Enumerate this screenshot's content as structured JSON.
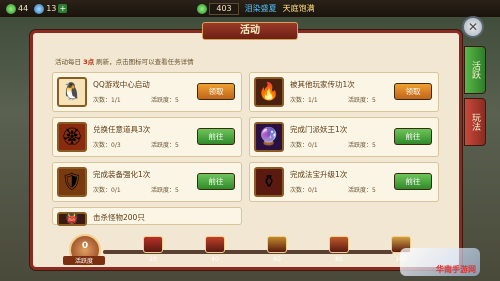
{
  "top_bar": {
    "level": "44",
    "stamina": "13",
    "gold": "403",
    "status1": "泪染盛夏",
    "status2": "天庭饱满"
  },
  "window": {
    "title": "活动",
    "close_icon": "close-icon"
  },
  "side_tabs": [
    {
      "label": "活跃"
    },
    {
      "label": "玩法"
    }
  ],
  "tip": {
    "prefix": "活动每日 ",
    "highlight": "3点",
    "suffix": " 刷新，点击图标可以查看任务详情"
  },
  "tasks": [
    {
      "name": "QQ游戏中心启动",
      "count": "次数：1/1",
      "active": "活跃度：5",
      "button": "领取",
      "type": "claim",
      "icon": "penguin-icon",
      "glyph": "🐧",
      "iconbg": "#f7e3b8"
    },
    {
      "name": "被其他玩家传功1次",
      "count": "次数：1/1",
      "active": "活跃度：5",
      "button": "领取",
      "type": "claim",
      "icon": "mage-silhouette-icon",
      "glyph": "🔥",
      "iconbg": "#4a2010"
    },
    {
      "name": "兑换任意道具3次",
      "count": "次数：0/3",
      "active": "活跃度：5",
      "button": "前往",
      "type": "go",
      "icon": "medallion-icon",
      "glyph": "🏵",
      "iconbg": "#8a2b10"
    },
    {
      "name": "完成门派妖王1次",
      "count": "次数：0/1",
      "active": "活跃度：5",
      "button": "前往",
      "type": "go",
      "icon": "purple-orb-icon",
      "glyph": "🔮",
      "iconbg": "#2a1040"
    },
    {
      "name": "完成装备强化1次",
      "count": "次数：0/1",
      "active": "活跃度：5",
      "button": "前往",
      "type": "go",
      "icon": "armor-icon",
      "glyph": "🛡",
      "iconbg": "#7a3a10"
    },
    {
      "name": "完成法宝升级1次",
      "count": "次数：0/1",
      "active": "活跃度：5",
      "button": "前往",
      "type": "go",
      "icon": "treasure-icon",
      "glyph": "⚱",
      "iconbg": "#5a1a10"
    },
    {
      "name": "击杀怪物200只",
      "count": "",
      "active": "",
      "button": "",
      "type": "",
      "icon": "monster-icon",
      "glyph": "👹",
      "iconbg": "#3a1a10"
    }
  ],
  "activity": {
    "value": "0",
    "label": "活跃度",
    "milestones": [
      {
        "value": "20",
        "color": "#b8302a"
      },
      {
        "value": "40",
        "color": "#c0402a"
      },
      {
        "value": "60",
        "color": "#c08a2a"
      },
      {
        "value": "80",
        "color": "#c05a2a"
      },
      {
        "value": "100",
        "color": "#d0a040"
      }
    ]
  },
  "watermark": "华南手游网"
}
